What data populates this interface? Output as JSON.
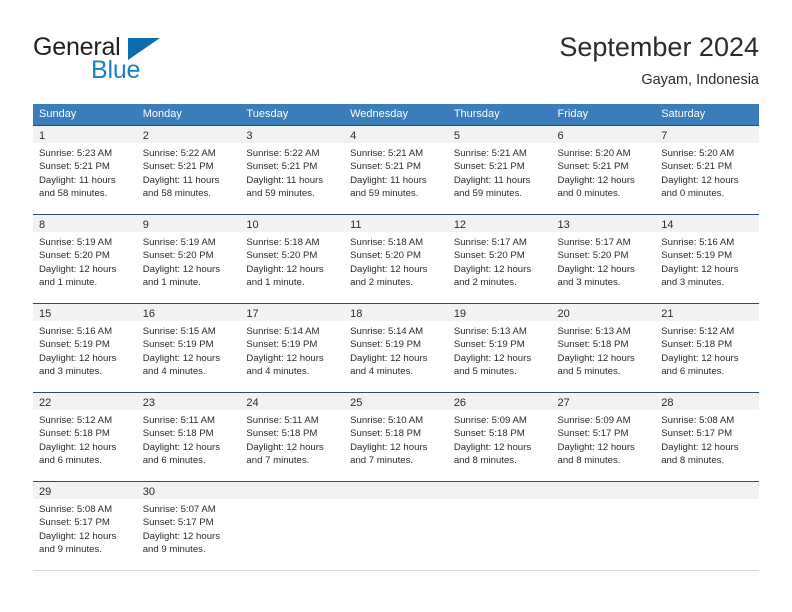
{
  "brand": {
    "name_part1": "General",
    "name_part2": "Blue",
    "triangle_color": "#0d6cb0",
    "blue_text_color": "#1b7fc4"
  },
  "header": {
    "title": "September 2024",
    "location": "Gayam, Indonesia"
  },
  "theme": {
    "header_row_bg": "#3b7cba",
    "header_row_text": "#ffffff",
    "week_separator": "#2b4b6f",
    "daynum_bar_bg": "#f2f2f2",
    "body_text": "#2b2b2b"
  },
  "weekdays": [
    "Sunday",
    "Monday",
    "Tuesday",
    "Wednesday",
    "Thursday",
    "Friday",
    "Saturday"
  ],
  "weeks": [
    {
      "days": [
        {
          "day": "1",
          "sunrise": "Sunrise: 5:23 AM",
          "sunset": "Sunset: 5:21 PM",
          "daylight1": "Daylight: 11 hours",
          "daylight2": "and 58 minutes."
        },
        {
          "day": "2",
          "sunrise": "Sunrise: 5:22 AM",
          "sunset": "Sunset: 5:21 PM",
          "daylight1": "Daylight: 11 hours",
          "daylight2": "and 58 minutes."
        },
        {
          "day": "3",
          "sunrise": "Sunrise: 5:22 AM",
          "sunset": "Sunset: 5:21 PM",
          "daylight1": "Daylight: 11 hours",
          "daylight2": "and 59 minutes."
        },
        {
          "day": "4",
          "sunrise": "Sunrise: 5:21 AM",
          "sunset": "Sunset: 5:21 PM",
          "daylight1": "Daylight: 11 hours",
          "daylight2": "and 59 minutes."
        },
        {
          "day": "5",
          "sunrise": "Sunrise: 5:21 AM",
          "sunset": "Sunset: 5:21 PM",
          "daylight1": "Daylight: 11 hours",
          "daylight2": "and 59 minutes."
        },
        {
          "day": "6",
          "sunrise": "Sunrise: 5:20 AM",
          "sunset": "Sunset: 5:21 PM",
          "daylight1": "Daylight: 12 hours",
          "daylight2": "and 0 minutes."
        },
        {
          "day": "7",
          "sunrise": "Sunrise: 5:20 AM",
          "sunset": "Sunset: 5:21 PM",
          "daylight1": "Daylight: 12 hours",
          "daylight2": "and 0 minutes."
        }
      ]
    },
    {
      "days": [
        {
          "day": "8",
          "sunrise": "Sunrise: 5:19 AM",
          "sunset": "Sunset: 5:20 PM",
          "daylight1": "Daylight: 12 hours",
          "daylight2": "and 1 minute."
        },
        {
          "day": "9",
          "sunrise": "Sunrise: 5:19 AM",
          "sunset": "Sunset: 5:20 PM",
          "daylight1": "Daylight: 12 hours",
          "daylight2": "and 1 minute."
        },
        {
          "day": "10",
          "sunrise": "Sunrise: 5:18 AM",
          "sunset": "Sunset: 5:20 PM",
          "daylight1": "Daylight: 12 hours",
          "daylight2": "and 1 minute."
        },
        {
          "day": "11",
          "sunrise": "Sunrise: 5:18 AM",
          "sunset": "Sunset: 5:20 PM",
          "daylight1": "Daylight: 12 hours",
          "daylight2": "and 2 minutes."
        },
        {
          "day": "12",
          "sunrise": "Sunrise: 5:17 AM",
          "sunset": "Sunset: 5:20 PM",
          "daylight1": "Daylight: 12 hours",
          "daylight2": "and 2 minutes."
        },
        {
          "day": "13",
          "sunrise": "Sunrise: 5:17 AM",
          "sunset": "Sunset: 5:20 PM",
          "daylight1": "Daylight: 12 hours",
          "daylight2": "and 3 minutes."
        },
        {
          "day": "14",
          "sunrise": "Sunrise: 5:16 AM",
          "sunset": "Sunset: 5:19 PM",
          "daylight1": "Daylight: 12 hours",
          "daylight2": "and 3 minutes."
        }
      ]
    },
    {
      "days": [
        {
          "day": "15",
          "sunrise": "Sunrise: 5:16 AM",
          "sunset": "Sunset: 5:19 PM",
          "daylight1": "Daylight: 12 hours",
          "daylight2": "and 3 minutes."
        },
        {
          "day": "16",
          "sunrise": "Sunrise: 5:15 AM",
          "sunset": "Sunset: 5:19 PM",
          "daylight1": "Daylight: 12 hours",
          "daylight2": "and 4 minutes."
        },
        {
          "day": "17",
          "sunrise": "Sunrise: 5:14 AM",
          "sunset": "Sunset: 5:19 PM",
          "daylight1": "Daylight: 12 hours",
          "daylight2": "and 4 minutes."
        },
        {
          "day": "18",
          "sunrise": "Sunrise: 5:14 AM",
          "sunset": "Sunset: 5:19 PM",
          "daylight1": "Daylight: 12 hours",
          "daylight2": "and 4 minutes."
        },
        {
          "day": "19",
          "sunrise": "Sunrise: 5:13 AM",
          "sunset": "Sunset: 5:19 PM",
          "daylight1": "Daylight: 12 hours",
          "daylight2": "and 5 minutes."
        },
        {
          "day": "20",
          "sunrise": "Sunrise: 5:13 AM",
          "sunset": "Sunset: 5:18 PM",
          "daylight1": "Daylight: 12 hours",
          "daylight2": "and 5 minutes."
        },
        {
          "day": "21",
          "sunrise": "Sunrise: 5:12 AM",
          "sunset": "Sunset: 5:18 PM",
          "daylight1": "Daylight: 12 hours",
          "daylight2": "and 6 minutes."
        }
      ]
    },
    {
      "days": [
        {
          "day": "22",
          "sunrise": "Sunrise: 5:12 AM",
          "sunset": "Sunset: 5:18 PM",
          "daylight1": "Daylight: 12 hours",
          "daylight2": "and 6 minutes."
        },
        {
          "day": "23",
          "sunrise": "Sunrise: 5:11 AM",
          "sunset": "Sunset: 5:18 PM",
          "daylight1": "Daylight: 12 hours",
          "daylight2": "and 6 minutes."
        },
        {
          "day": "24",
          "sunrise": "Sunrise: 5:11 AM",
          "sunset": "Sunset: 5:18 PM",
          "daylight1": "Daylight: 12 hours",
          "daylight2": "and 7 minutes."
        },
        {
          "day": "25",
          "sunrise": "Sunrise: 5:10 AM",
          "sunset": "Sunset: 5:18 PM",
          "daylight1": "Daylight: 12 hours",
          "daylight2": "and 7 minutes."
        },
        {
          "day": "26",
          "sunrise": "Sunrise: 5:09 AM",
          "sunset": "Sunset: 5:18 PM",
          "daylight1": "Daylight: 12 hours",
          "daylight2": "and 8 minutes."
        },
        {
          "day": "27",
          "sunrise": "Sunrise: 5:09 AM",
          "sunset": "Sunset: 5:17 PM",
          "daylight1": "Daylight: 12 hours",
          "daylight2": "and 8 minutes."
        },
        {
          "day": "28",
          "sunrise": "Sunrise: 5:08 AM",
          "sunset": "Sunset: 5:17 PM",
          "daylight1": "Daylight: 12 hours",
          "daylight2": "and 8 minutes."
        }
      ]
    },
    {
      "days": [
        {
          "day": "29",
          "sunrise": "Sunrise: 5:08 AM",
          "sunset": "Sunset: 5:17 PM",
          "daylight1": "Daylight: 12 hours",
          "daylight2": "and 9 minutes."
        },
        {
          "day": "30",
          "sunrise": "Sunrise: 5:07 AM",
          "sunset": "Sunset: 5:17 PM",
          "daylight1": "Daylight: 12 hours",
          "daylight2": "and 9 minutes."
        },
        {
          "day": "",
          "sunrise": "",
          "sunset": "",
          "daylight1": "",
          "daylight2": ""
        },
        {
          "day": "",
          "sunrise": "",
          "sunset": "",
          "daylight1": "",
          "daylight2": ""
        },
        {
          "day": "",
          "sunrise": "",
          "sunset": "",
          "daylight1": "",
          "daylight2": ""
        },
        {
          "day": "",
          "sunrise": "",
          "sunset": "",
          "daylight1": "",
          "daylight2": ""
        },
        {
          "day": "",
          "sunrise": "",
          "sunset": "",
          "daylight1": "",
          "daylight2": ""
        }
      ]
    }
  ]
}
